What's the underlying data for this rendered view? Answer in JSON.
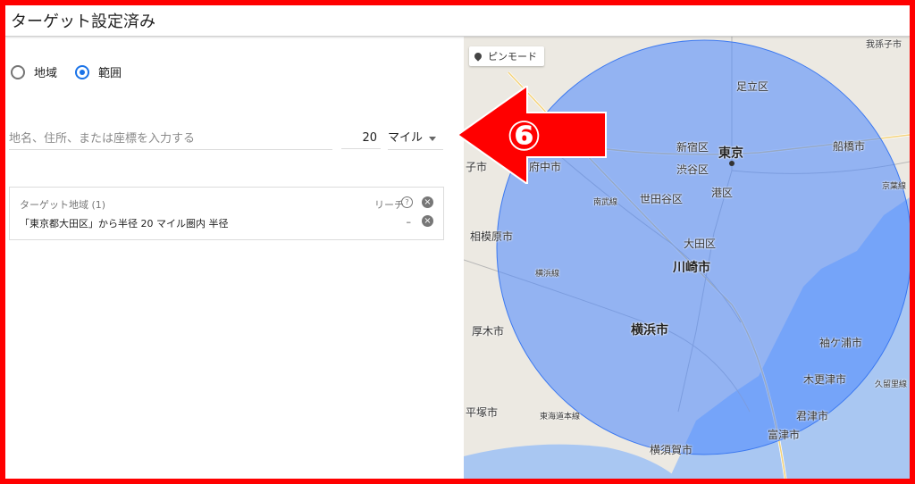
{
  "header": {
    "title": "ターゲット設定済み"
  },
  "mode": {
    "options": [
      {
        "label": "地域",
        "selected": false
      },
      {
        "label": "範囲",
        "selected": true
      }
    ]
  },
  "search": {
    "placeholder": "地名、住所、または座標を入力する",
    "radius": "20",
    "unit": "マイル"
  },
  "target_card": {
    "title": "ターゲット地域 (1)",
    "reach_label": "リーチ",
    "entry": "「東京都大田区」から半径 20 マイル圏内 半径",
    "entry_reach": "–"
  },
  "map": {
    "pin_mode_label": "ピンモード",
    "cities": [
      {
        "name": "足立区"
      },
      {
        "name": "新宿区"
      },
      {
        "name": "東京"
      },
      {
        "name": "渋谷区"
      },
      {
        "name": "船橋市"
      },
      {
        "name": "府中市"
      },
      {
        "name": "世田谷区"
      },
      {
        "name": "港区"
      },
      {
        "name": "相模原市"
      },
      {
        "name": "大田区"
      },
      {
        "name": "川崎市"
      },
      {
        "name": "厚木市"
      },
      {
        "name": "横浜市"
      },
      {
        "name": "袖ケ浦市"
      },
      {
        "name": "木更津市"
      },
      {
        "name": "平塚市"
      },
      {
        "name": "君津市"
      },
      {
        "name": "富津市"
      },
      {
        "name": "横須賀市"
      },
      {
        "name": "子市"
      },
      {
        "name": "東海道本線"
      },
      {
        "name": "南武線"
      },
      {
        "name": "横浜線"
      },
      {
        "name": "久留里線"
      },
      {
        "name": "京葉線"
      },
      {
        "name": "我孫子市"
      }
    ],
    "overlay_color": "#4a86ff",
    "callout_number": "⑥",
    "callout_color": "#ff0000"
  }
}
